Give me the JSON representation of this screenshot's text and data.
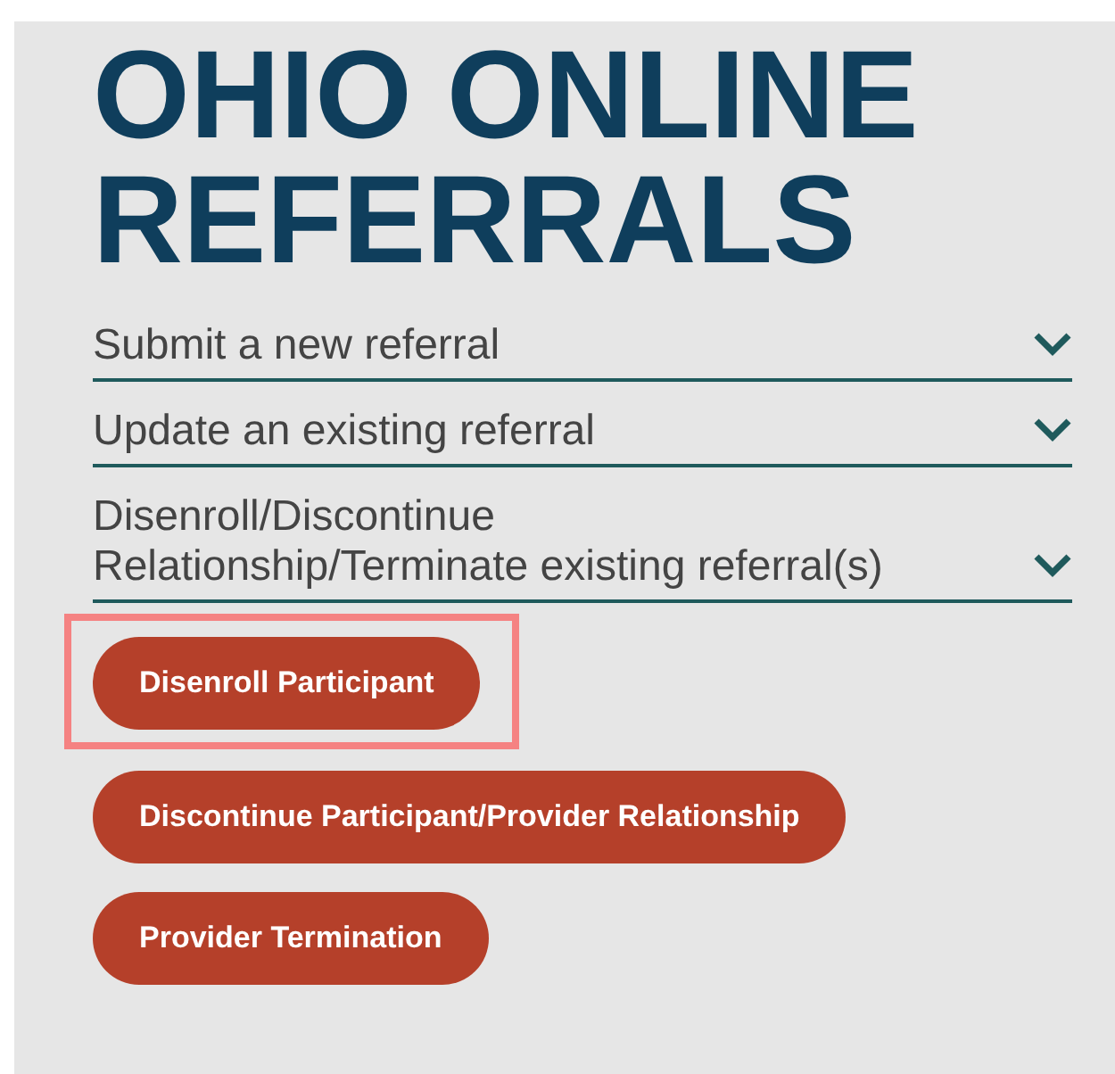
{
  "title": "OHIO ONLINE REFERRALS",
  "sections": [
    {
      "label": "Submit a new referral"
    },
    {
      "label": "Update an existing referral"
    },
    {
      "label": "Disenroll/Discontinue Relationship/Terminate existing referral(s)",
      "buttons": [
        {
          "label": "Disenroll Participant",
          "highlighted": true
        },
        {
          "label": "Discontinue Participant/Provider Relationship",
          "highlighted": false
        },
        {
          "label": "Provider Termination",
          "highlighted": false
        }
      ]
    }
  ]
}
